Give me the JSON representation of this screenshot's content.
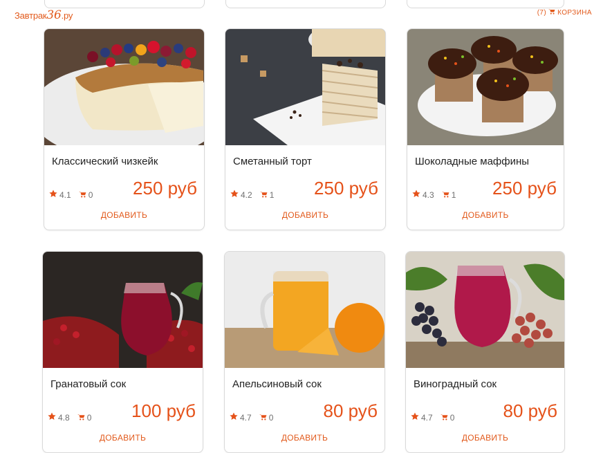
{
  "header": {
    "logo_text": "Завтрак",
    "logo_number": "36",
    "logo_suffix": ".ру",
    "cart_count": "(7)",
    "cart_label": "КОРЗИНА"
  },
  "colors": {
    "accent": "#e5521a",
    "border": "#d9d9d9",
    "muted": "#6f6f6f"
  },
  "products": [
    {
      "name": "Классический чизкейк",
      "rating": "4.1",
      "cart": "0",
      "price": "250 руб",
      "add_label": "ДОБАВИТЬ",
      "image": "cheesecake-with-berries"
    },
    {
      "name": "Сметанный торт",
      "rating": "4.2",
      "cart": "1",
      "price": "250 руб",
      "add_label": "ДОБАВИТЬ",
      "image": "sour-cream-cake-slice"
    },
    {
      "name": "Шоколадные маффины",
      "rating": "4.3",
      "cart": "1",
      "price": "250 руб",
      "add_label": "ДОБАВИТЬ",
      "image": "chocolate-muffins"
    },
    {
      "name": "Гранатовый сок",
      "rating": "4.8",
      "cart": "0",
      "price": "100 руб",
      "add_label": "ДОБАВИТЬ",
      "image": "pomegranate-juice-jug"
    },
    {
      "name": "Апельсиновый сок",
      "rating": "4.7",
      "cart": "0",
      "price": "80 руб",
      "add_label": "ДОБАВИТЬ",
      "image": "orange-juice-jar"
    },
    {
      "name": "Виноградный сок",
      "rating": "4.7",
      "cart": "0",
      "price": "80 руб",
      "add_label": "ДОБАВИТЬ",
      "image": "grape-juice-jug"
    }
  ]
}
